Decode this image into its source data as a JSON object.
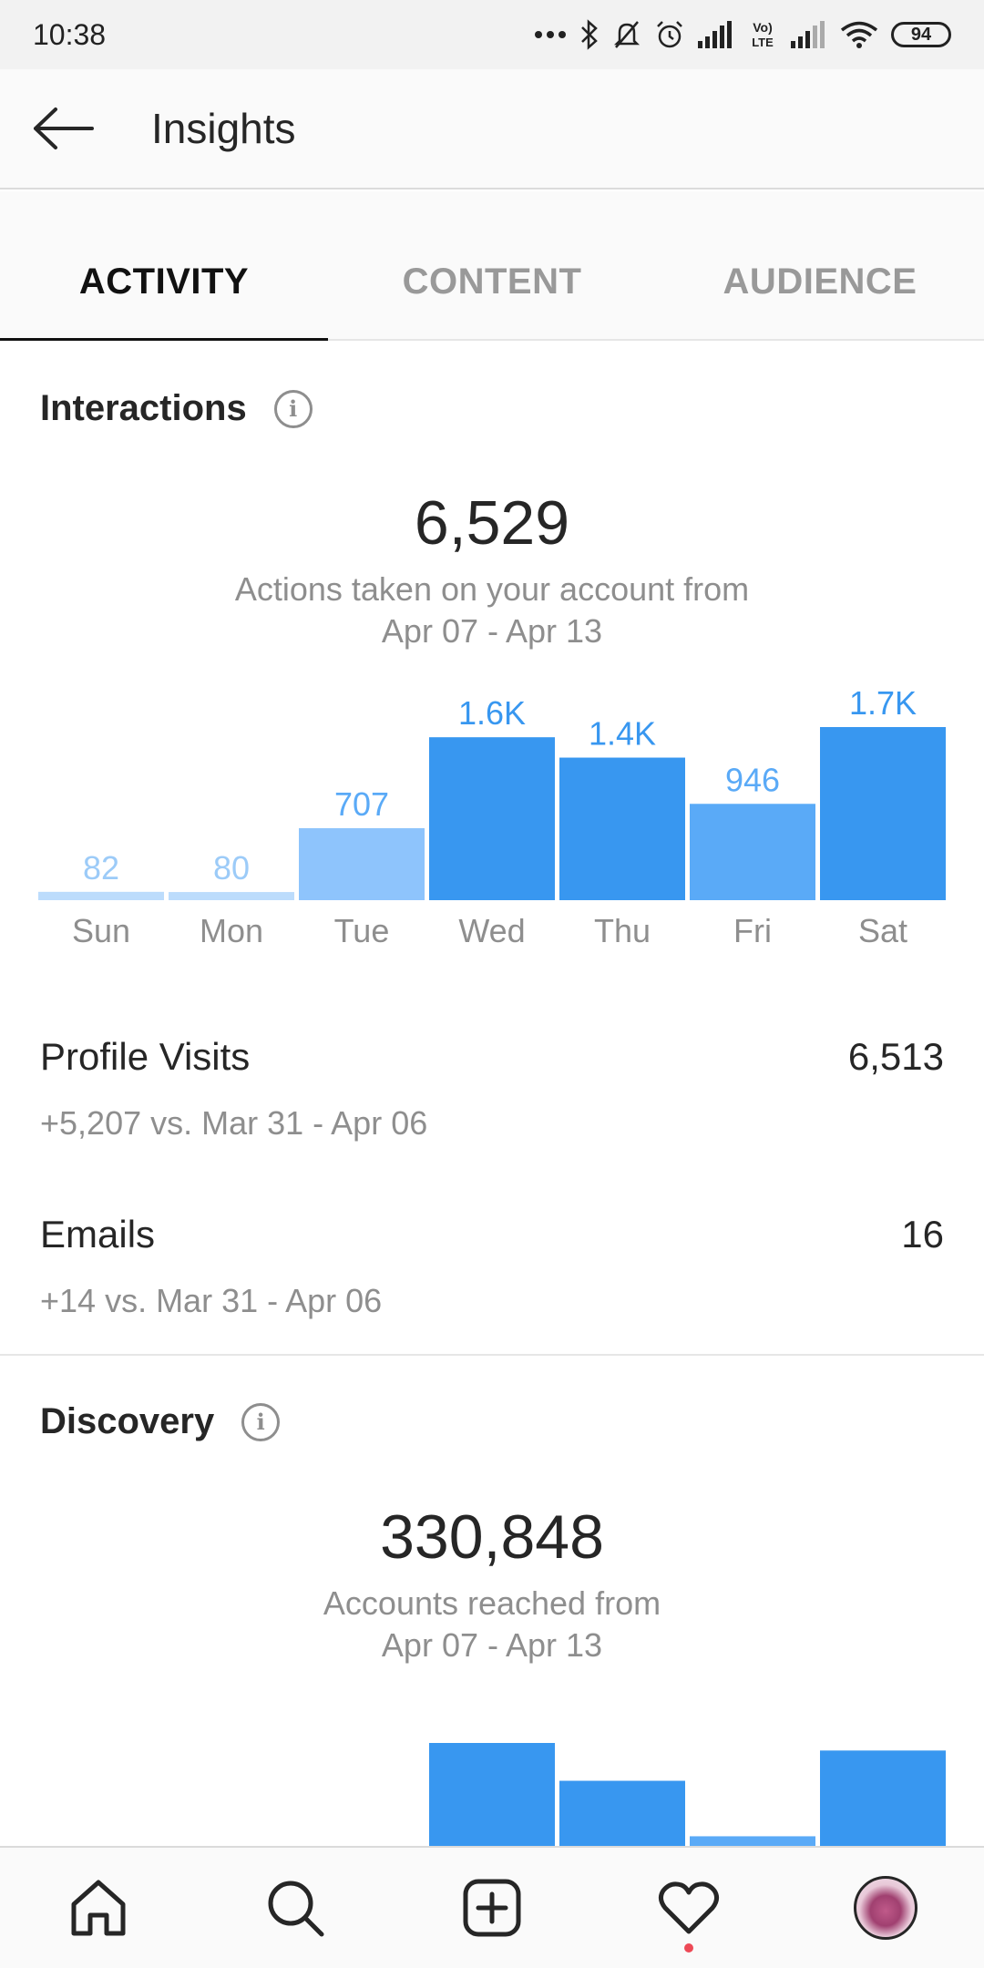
{
  "status_bar": {
    "time": "10:38",
    "battery": "94",
    "network_label": "Vo LTE"
  },
  "header": {
    "title": "Insights"
  },
  "tabs": [
    {
      "label": "ACTIVITY",
      "active": true
    },
    {
      "label": "CONTENT",
      "active": false
    },
    {
      "label": "AUDIENCE",
      "active": false
    }
  ],
  "interactions": {
    "title": "Interactions",
    "total": "6,529",
    "caption_line1": "Actions taken on your account from",
    "caption_line2": "Apr 07 - Apr 13"
  },
  "chart_data": [
    {
      "type": "bar",
      "categories": [
        "Sun",
        "Mon",
        "Tue",
        "Wed",
        "Thu",
        "Fri",
        "Sat"
      ],
      "values": [
        82,
        80,
        707,
        1600,
        1400,
        946,
        1700
      ],
      "data_labels": [
        "82",
        "80",
        "707",
        "1.6K",
        "1.4K",
        "946",
        "1.7K"
      ],
      "colors": [
        "#bcdcfc",
        "#bcdcfc",
        "#8ec4fc",
        "#3897f0",
        "#3897f0",
        "#5aaaf7",
        "#3897f0"
      ],
      "label_colors": [
        "#9ccbf8",
        "#9ccbf8",
        "#5aaaf7",
        "#3897f0",
        "#3897f0",
        "#5aaaf7",
        "#3897f0"
      ]
    },
    {
      "type": "bar",
      "categories": [
        "Sun",
        "Mon",
        "Tue",
        "Wed",
        "Thu",
        "Fri",
        "Sat"
      ],
      "values": [
        0,
        0,
        40000,
        82000,
        67000,
        45000,
        79000
      ],
      "colors": [
        "#bcdcfc",
        "#bcdcfc",
        "#5aaaf7",
        "#3897f0",
        "#3897f0",
        "#5aaaf7",
        "#3897f0"
      ]
    }
  ],
  "stats": [
    {
      "label": "Profile Visits",
      "value": "6,513",
      "sub": "+5,207 vs. Mar 31 - Apr 06"
    },
    {
      "label": "Emails",
      "value": "16",
      "sub": "+14 vs. Mar 31 - Apr 06"
    }
  ],
  "discovery": {
    "title": "Discovery",
    "total": "330,848",
    "caption_line1": "Accounts reached from",
    "caption_line2": "Apr 07 - Apr 13"
  },
  "nav_icons": [
    "home-icon",
    "search-icon",
    "add-post-icon",
    "heart-icon",
    "profile-avatar"
  ],
  "info_glyph": "i"
}
